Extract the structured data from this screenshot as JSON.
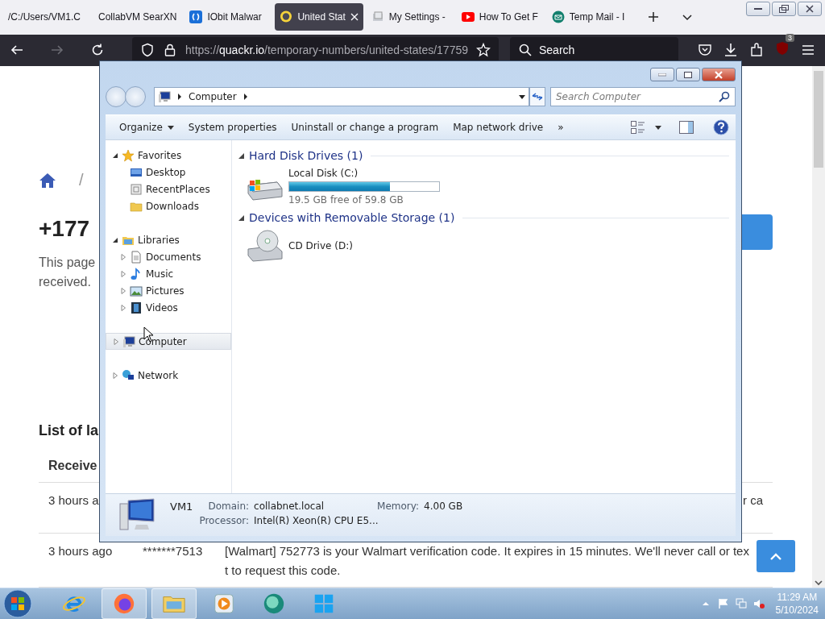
{
  "browser": {
    "tabs": [
      {
        "title": "/C:/Users/VM1.C",
        "kind": "none",
        "selected": false
      },
      {
        "title": "CollabVM SearXN",
        "kind": "none",
        "selected": false
      },
      {
        "title": "IObit Malwar",
        "kind": "iobit",
        "selected": false
      },
      {
        "title": "United Stat",
        "kind": "chat",
        "selected": true
      },
      {
        "title": "My Settings -",
        "kind": "settings",
        "selected": false
      },
      {
        "title": "How To Get F",
        "kind": "video",
        "selected": false
      },
      {
        "title": "Temp Mail - I",
        "kind": "mail",
        "selected": false
      }
    ],
    "url": {
      "scheme": "https://",
      "host": "quackr.io",
      "path": "/temporary-numbers/united-states/17759"
    },
    "search_placeholder": "Search",
    "extension_badge": "3"
  },
  "page": {
    "breadcrumb_separator": "/",
    "heading": "+177",
    "intro_lines": [
      "This page",
      "received."
    ],
    "list_heading": "List of la",
    "table_header": "Receive",
    "rows": [
      {
        "time": "3 hours a",
        "message_end": "r ca"
      },
      {
        "time": "3 hours ago",
        "sender": "*******7513",
        "message": "[Walmart] 752773 is your Walmart verification code. It expires in 15 minutes. We'll never call or text to request this code."
      }
    ]
  },
  "explorer": {
    "address": "Computer",
    "search_placeholder": "Search Computer",
    "toolbar": [
      {
        "label": "Organize",
        "dropdown": true
      },
      {
        "label": "System properties",
        "dropdown": false
      },
      {
        "label": "Uninstall or change a program",
        "dropdown": false
      },
      {
        "label": "Map network drive",
        "dropdown": false
      }
    ],
    "toolbar_overflow": "»",
    "nav": [
      {
        "label": "Favorites",
        "kind": "star",
        "expanded": true,
        "selected": false,
        "children": [
          {
            "label": "Desktop",
            "kind": "desktop",
            "selected": false
          },
          {
            "label": "RecentPlaces",
            "kind": "recent",
            "selected": false
          },
          {
            "label": "Downloads",
            "kind": "folder",
            "selected": false
          }
        ]
      },
      {
        "label": "Libraries",
        "kind": "library",
        "expanded": true,
        "selected": false,
        "children": [
          {
            "label": "Documents",
            "kind": "document",
            "expanded": false,
            "selected": false
          },
          {
            "label": "Music",
            "kind": "music",
            "expanded": false,
            "selected": false
          },
          {
            "label": "Pictures",
            "kind": "picture",
            "expanded": false,
            "selected": false
          },
          {
            "label": "Videos",
            "kind": "video",
            "expanded": false,
            "selected": false
          }
        ]
      },
      {
        "label": "Computer",
        "kind": "computer",
        "expanded": false,
        "selected": true
      },
      {
        "label": "Network",
        "kind": "network",
        "expanded": false,
        "selected": false
      }
    ],
    "groups": [
      {
        "title": "Hard Disk Drives (1)",
        "expanded": true,
        "items": [
          {
            "name": "Local Disk (C:)",
            "kind": "hdd",
            "level": 0.674,
            "free": "19.5 GB free of 59.8 GB"
          }
        ]
      },
      {
        "title": "Devices with Removable Storage (1)",
        "expanded": true,
        "items": [
          {
            "name": "CD Drive (D:)",
            "kind": "cd"
          }
        ]
      }
    ],
    "details": {
      "name": "VM1",
      "fields": [
        {
          "label": "Domain:",
          "value": "collabnet.local"
        },
        {
          "label": "Memory:",
          "value": "4.00 GB"
        },
        {
          "label": "Processor:",
          "value": "Intel(R) Xeon(R) CPU E5..."
        }
      ]
    }
  },
  "taskbar": {
    "apps": [
      {
        "kind": "ie",
        "active": false
      },
      {
        "kind": "firefox",
        "active": true
      },
      {
        "kind": "explorer",
        "active": true
      },
      {
        "kind": "media",
        "active": false
      },
      {
        "kind": "globe",
        "active": false
      },
      {
        "kind": "windows",
        "active": false
      }
    ],
    "time": "11:29 AM",
    "date": "5/10/2024"
  }
}
